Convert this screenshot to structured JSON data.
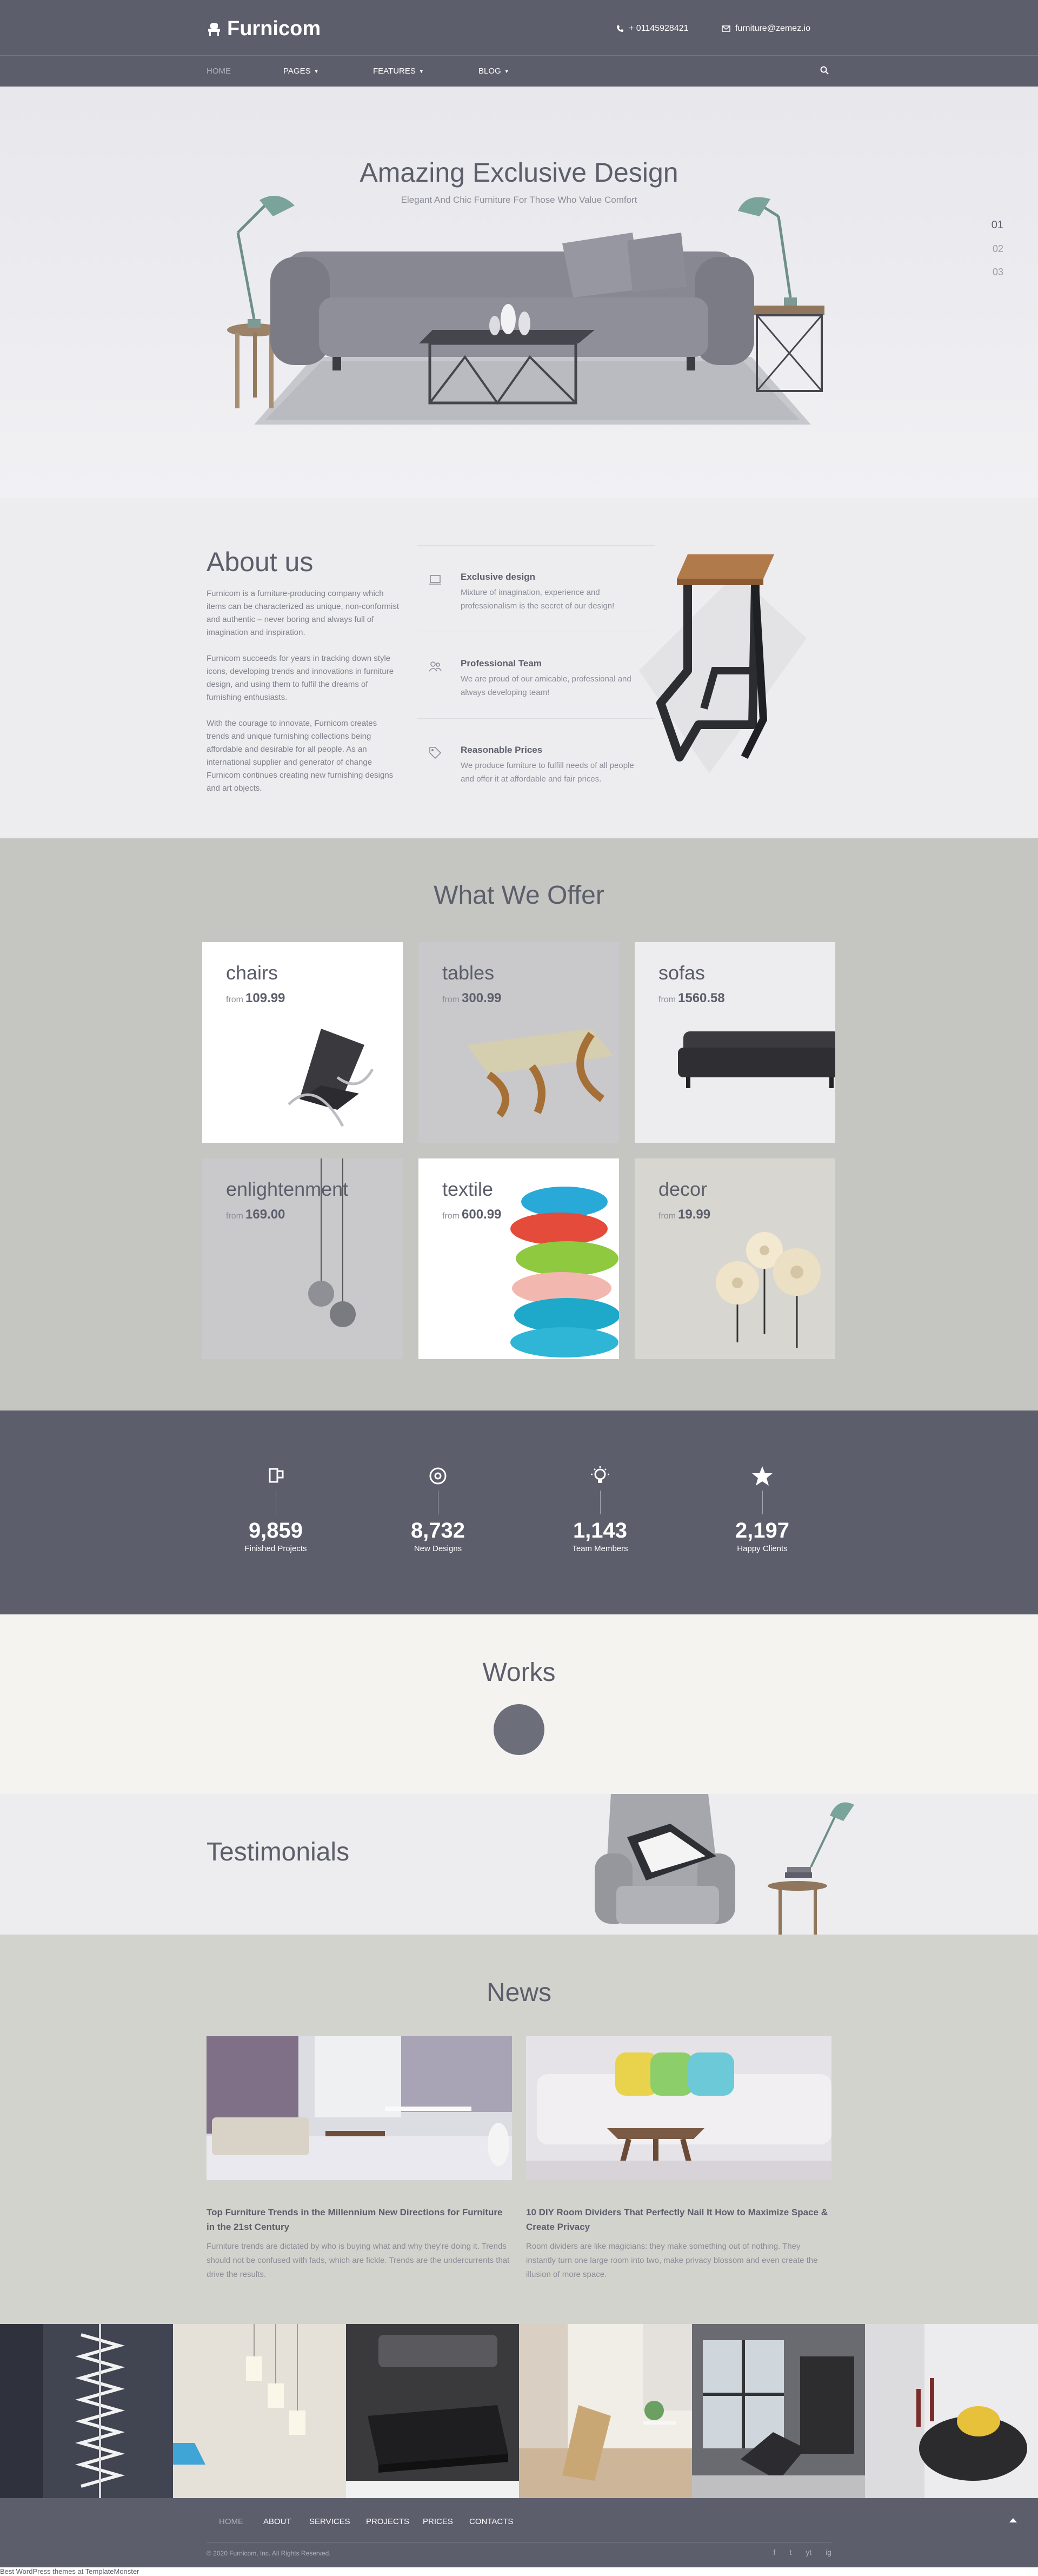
{
  "header": {
    "logo_text": "Furnicom",
    "phone": "+ 01145928421",
    "email": "furniture@zemez.io",
    "nav": [
      {
        "label": "Home",
        "active": true
      },
      {
        "label": "Pages",
        "dropdown": true
      },
      {
        "label": "Features",
        "dropdown": true
      },
      {
        "label": "Blog",
        "dropdown": true
      }
    ]
  },
  "hero": {
    "title": "Amazing Exclusive Design",
    "subtitle": "Elegant And Chic Furniture For Those Who Value Comfort",
    "slides": [
      "01",
      "02",
      "03"
    ],
    "active_slide": "01"
  },
  "about": {
    "title": "About us",
    "paragraphs": [
      "Furnicom is a furniture-producing company which items can be characterized as unique, non-conformist and authentic – never boring and always full of imagination and inspiration.",
      "Furnicom succeeds for years in tracking down style icons, developing trends and innovations in furniture design, and using them to fulfil the dreams of furnishing enthusiasts.",
      "With the courage to innovate, Furnicom creates trends and unique furnishing collections being affordable and desirable for all people. As an international supplier and generator of change Furnicom continues creating new furnishing designs and art objects."
    ],
    "features": [
      {
        "title": "Exclusive design",
        "text": "Mixture of imagination, experience and professionalism is the secret of our design!",
        "icon": "design-icon"
      },
      {
        "title": "Professional Team",
        "text": "We are proud of our amicable, professional and always developing team!",
        "icon": "team-icon"
      },
      {
        "title": "Reasonable Prices",
        "text": "We produce furniture to fulfill needs of all people and offer it at affordable and fair prices.",
        "icon": "price-tag-icon"
      }
    ]
  },
  "offer": {
    "title": "What We Offer",
    "from_label": "from",
    "items": [
      {
        "name": "chairs",
        "price": "109.99"
      },
      {
        "name": "tables",
        "price": "300.99"
      },
      {
        "name": "sofas",
        "price": "1560.58"
      },
      {
        "name": "enlightenment",
        "price": "169.00"
      },
      {
        "name": "textile",
        "price": "600.99"
      },
      {
        "name": "decor",
        "price": "19.99"
      }
    ]
  },
  "stats": [
    {
      "value": "9,859",
      "label": "Finished Projects",
      "icon": "projects-icon"
    },
    {
      "value": "8,732",
      "label": "New Designs",
      "icon": "gear-icon"
    },
    {
      "value": "1,143",
      "label": "Team Members",
      "icon": "lightbulb-icon"
    },
    {
      "value": "2,197",
      "label": "Happy Clients",
      "icon": "star-icon"
    }
  ],
  "works": {
    "title": "Works"
  },
  "testimonials": {
    "title": "Testimonials"
  },
  "news": {
    "title": "News",
    "items": [
      {
        "title": "Top Furniture Trends in the Millennium New Directions for Furniture in the 21st Century",
        "text": "Furniture trends are dictated by who is buying what and why they're doing it. Trends should not be confused with fads, which are fickle. Trends are the undercurrents that drive the results."
      },
      {
        "title": "10 DIY Room Dividers That Perfectly Nail It How to Maximize Space & Create Privacy",
        "text": "Room dividers are like magicians: they make something out of nothing. They instantly turn one large room into two, make privacy blossom and even create the illusion of more space."
      }
    ]
  },
  "footer": {
    "nav": [
      {
        "label": "Home",
        "active": true
      },
      {
        "label": "About"
      },
      {
        "label": "Services"
      },
      {
        "label": "Projects"
      },
      {
        "label": "Prices"
      },
      {
        "label": "Contacts"
      }
    ],
    "copyright": "© 2020 Furnicom, Inc. All Rights Reserved.",
    "social": [
      "f",
      "t",
      "yt",
      "ig"
    ],
    "credits": "Best WordPress themes at TemplateMonster"
  },
  "colors": {
    "primary": "#5c5e6b",
    "offer_bg": "#c5c6c1",
    "news_bg": "#d3d3ce",
    "works_bg": "#f4f3f0"
  }
}
